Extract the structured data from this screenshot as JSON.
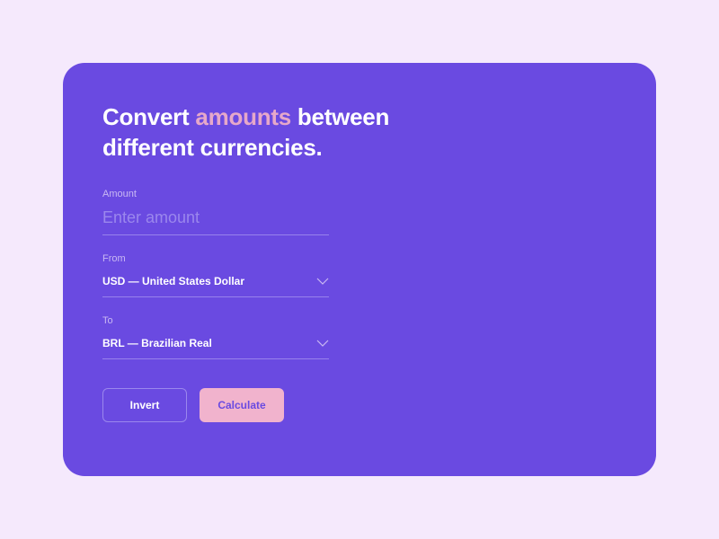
{
  "heading": {
    "part1": "Convert ",
    "accent": "amounts",
    "part2": " between different currencies."
  },
  "form": {
    "amount": {
      "label": "Amount",
      "placeholder": "Enter amount",
      "value": ""
    },
    "from": {
      "label": "From",
      "selected": "USD — United States Dollar"
    },
    "to": {
      "label": "To",
      "selected": "BRL — Brazilian Real"
    }
  },
  "buttons": {
    "invert": "Invert",
    "calculate": "Calculate"
  }
}
